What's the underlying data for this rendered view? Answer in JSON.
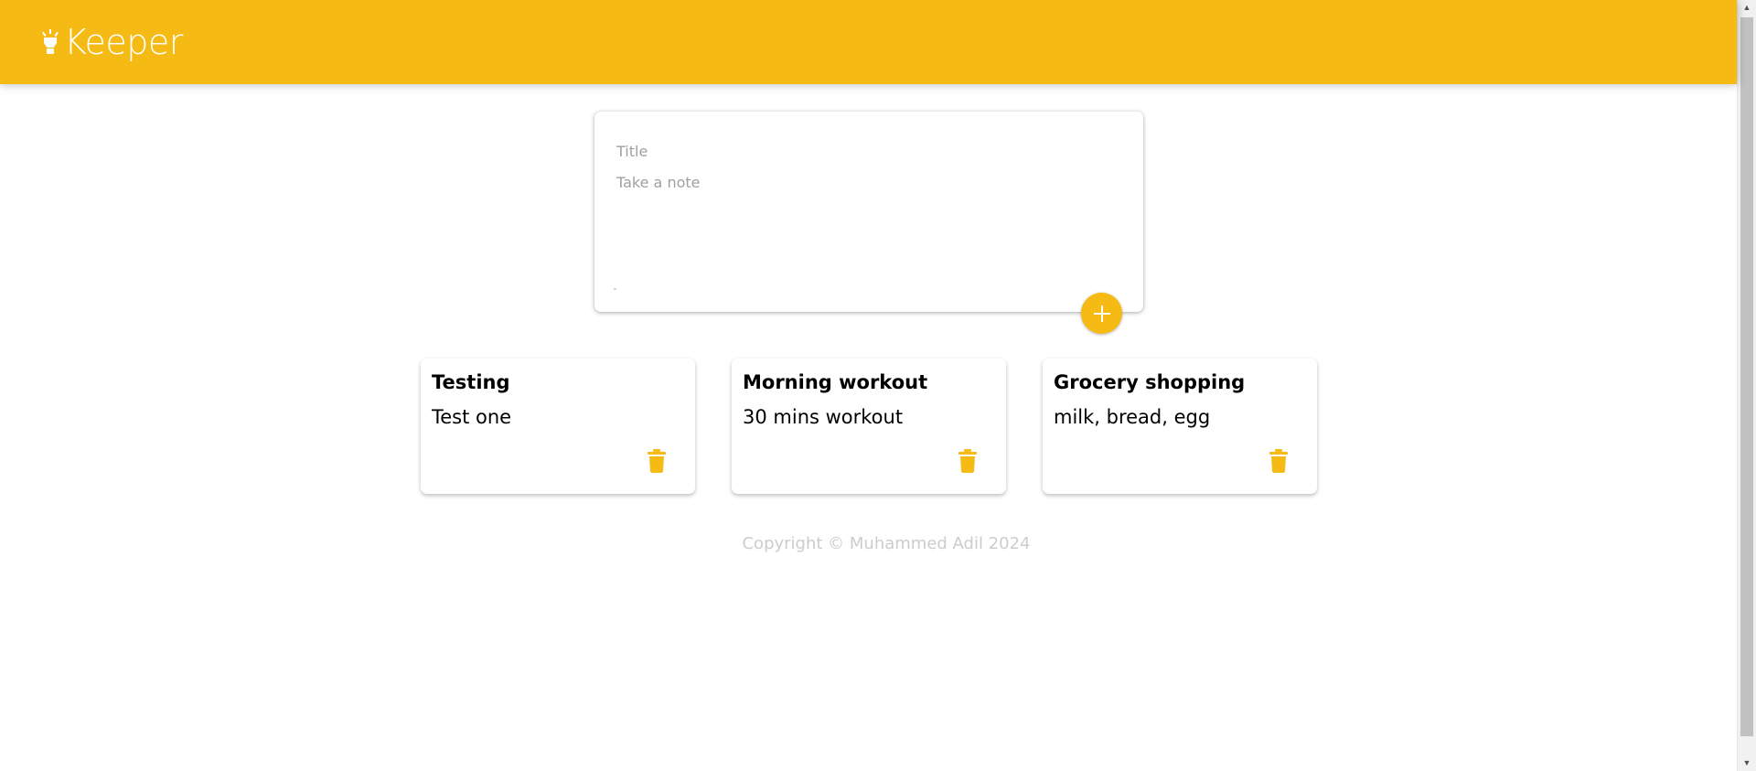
{
  "header": {
    "app_title": "Keeper"
  },
  "create_note": {
    "title_placeholder": "Title",
    "title_value": "",
    "content_placeholder": "Take a note",
    "content_value": ""
  },
  "notes": [
    {
      "title": "Testing",
      "content": "Test one"
    },
    {
      "title": "Morning workout",
      "content": "30 mins workout"
    },
    {
      "title": "Grocery shopping",
      "content": "milk, bread, egg"
    }
  ],
  "footer": {
    "copyright": "Copyright © Muhammed Adil 2024"
  },
  "icons": {
    "brand": "lightbulb-icon",
    "add": "plus-icon",
    "delete": "trash-icon"
  },
  "colors": {
    "accent": "#f5ba13",
    "footer_text": "#cccccc",
    "background": "#ffffff"
  }
}
